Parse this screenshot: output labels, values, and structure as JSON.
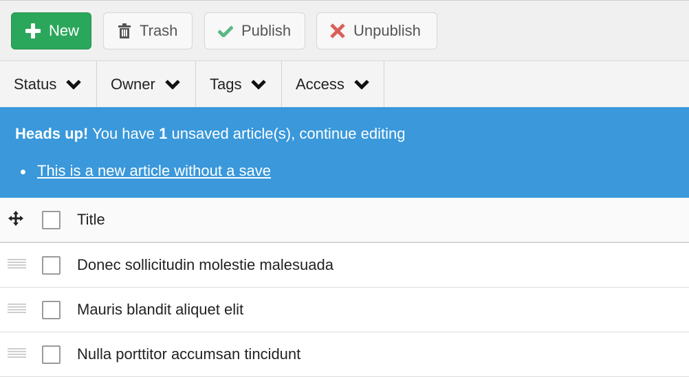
{
  "toolbar": {
    "new_label": "New",
    "trash_label": "Trash",
    "publish_label": "Publish",
    "unpublish_label": "Unpublish",
    "colors": {
      "new_bg": "#2aa75b",
      "publish_icon": "#5cb884",
      "unpublish_icon": "#d9605a"
    }
  },
  "filters": [
    {
      "label": "Status"
    },
    {
      "label": "Owner"
    },
    {
      "label": "Tags"
    },
    {
      "label": "Access"
    }
  ],
  "alert": {
    "heading": "Heads up!",
    "text_before": " You have ",
    "count": "1",
    "text_after": " unsaved article(s), continue editing",
    "link": "This is a new article without a save",
    "color": "#3a98db"
  },
  "table": {
    "header": {
      "title": "Title"
    },
    "rows": [
      {
        "title": "Donec sollicitudin molestie malesuada"
      },
      {
        "title": "Mauris blandit aliquet elit"
      },
      {
        "title": "Nulla porttitor accumsan tincidunt"
      }
    ]
  }
}
